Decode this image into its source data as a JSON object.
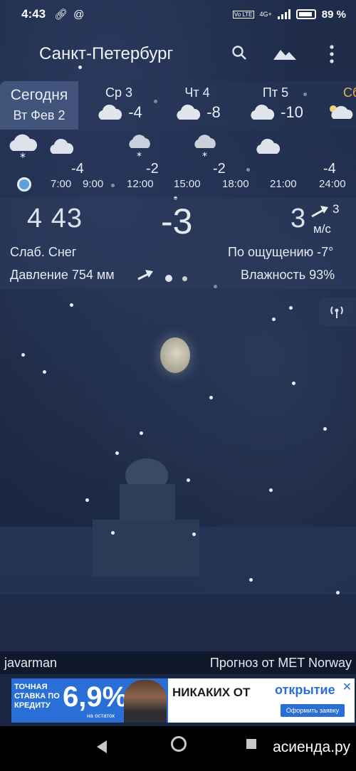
{
  "status": {
    "time": "4:43",
    "network": "4G+",
    "battery": "89 %",
    "volte": "Vo LTE"
  },
  "toolbar": {
    "city": "Санкт-Петербург",
    "icons": [
      "search-icon",
      "landscape-icon",
      "more-vert-icon"
    ]
  },
  "days": {
    "today": {
      "line1": "Сегодня",
      "line2": "Вт Фев 2"
    },
    "items": [
      {
        "name": "Ср 3",
        "temp": "-4",
        "icon": "cloud-icon"
      },
      {
        "name": "Чт 4",
        "temp": "-8",
        "icon": "cloud-icon"
      },
      {
        "name": "Пт 5",
        "temp": "-10",
        "icon": "cloud-icon"
      },
      {
        "name": "Сб",
        "temp": "",
        "icon": "partly-sunny-icon"
      }
    ]
  },
  "hourly": {
    "times": [
      "7:00",
      "9:00",
      "12:00",
      "15:00",
      "18:00",
      "21:00",
      "24:00"
    ],
    "temps": [
      "-4",
      "-2",
      "-2",
      "-4"
    ]
  },
  "current": {
    "time": "4 43",
    "temp": "-3",
    "wind": "3",
    "gust": "3",
    "wind_unit": "м/с",
    "condition": "Слаб. Снег",
    "feels_like": "По ощущению -7°",
    "pressure": "Давление 754 мм",
    "humidity": "Влажность 93%"
  },
  "footer": {
    "author": "javarman",
    "source": "Прогноз от MET Norway"
  },
  "ad": {
    "promo": "ТОЧНАЯ СТАВКА ПО КРЕДИТУ",
    "rate": "6,9%",
    "rate_note": "на остаток",
    "headline": "НИКАКИХ ОТ",
    "brand": "открытие",
    "button": "Оформить заявку",
    "close": "✕"
  },
  "watermark": "асиенда.ру"
}
